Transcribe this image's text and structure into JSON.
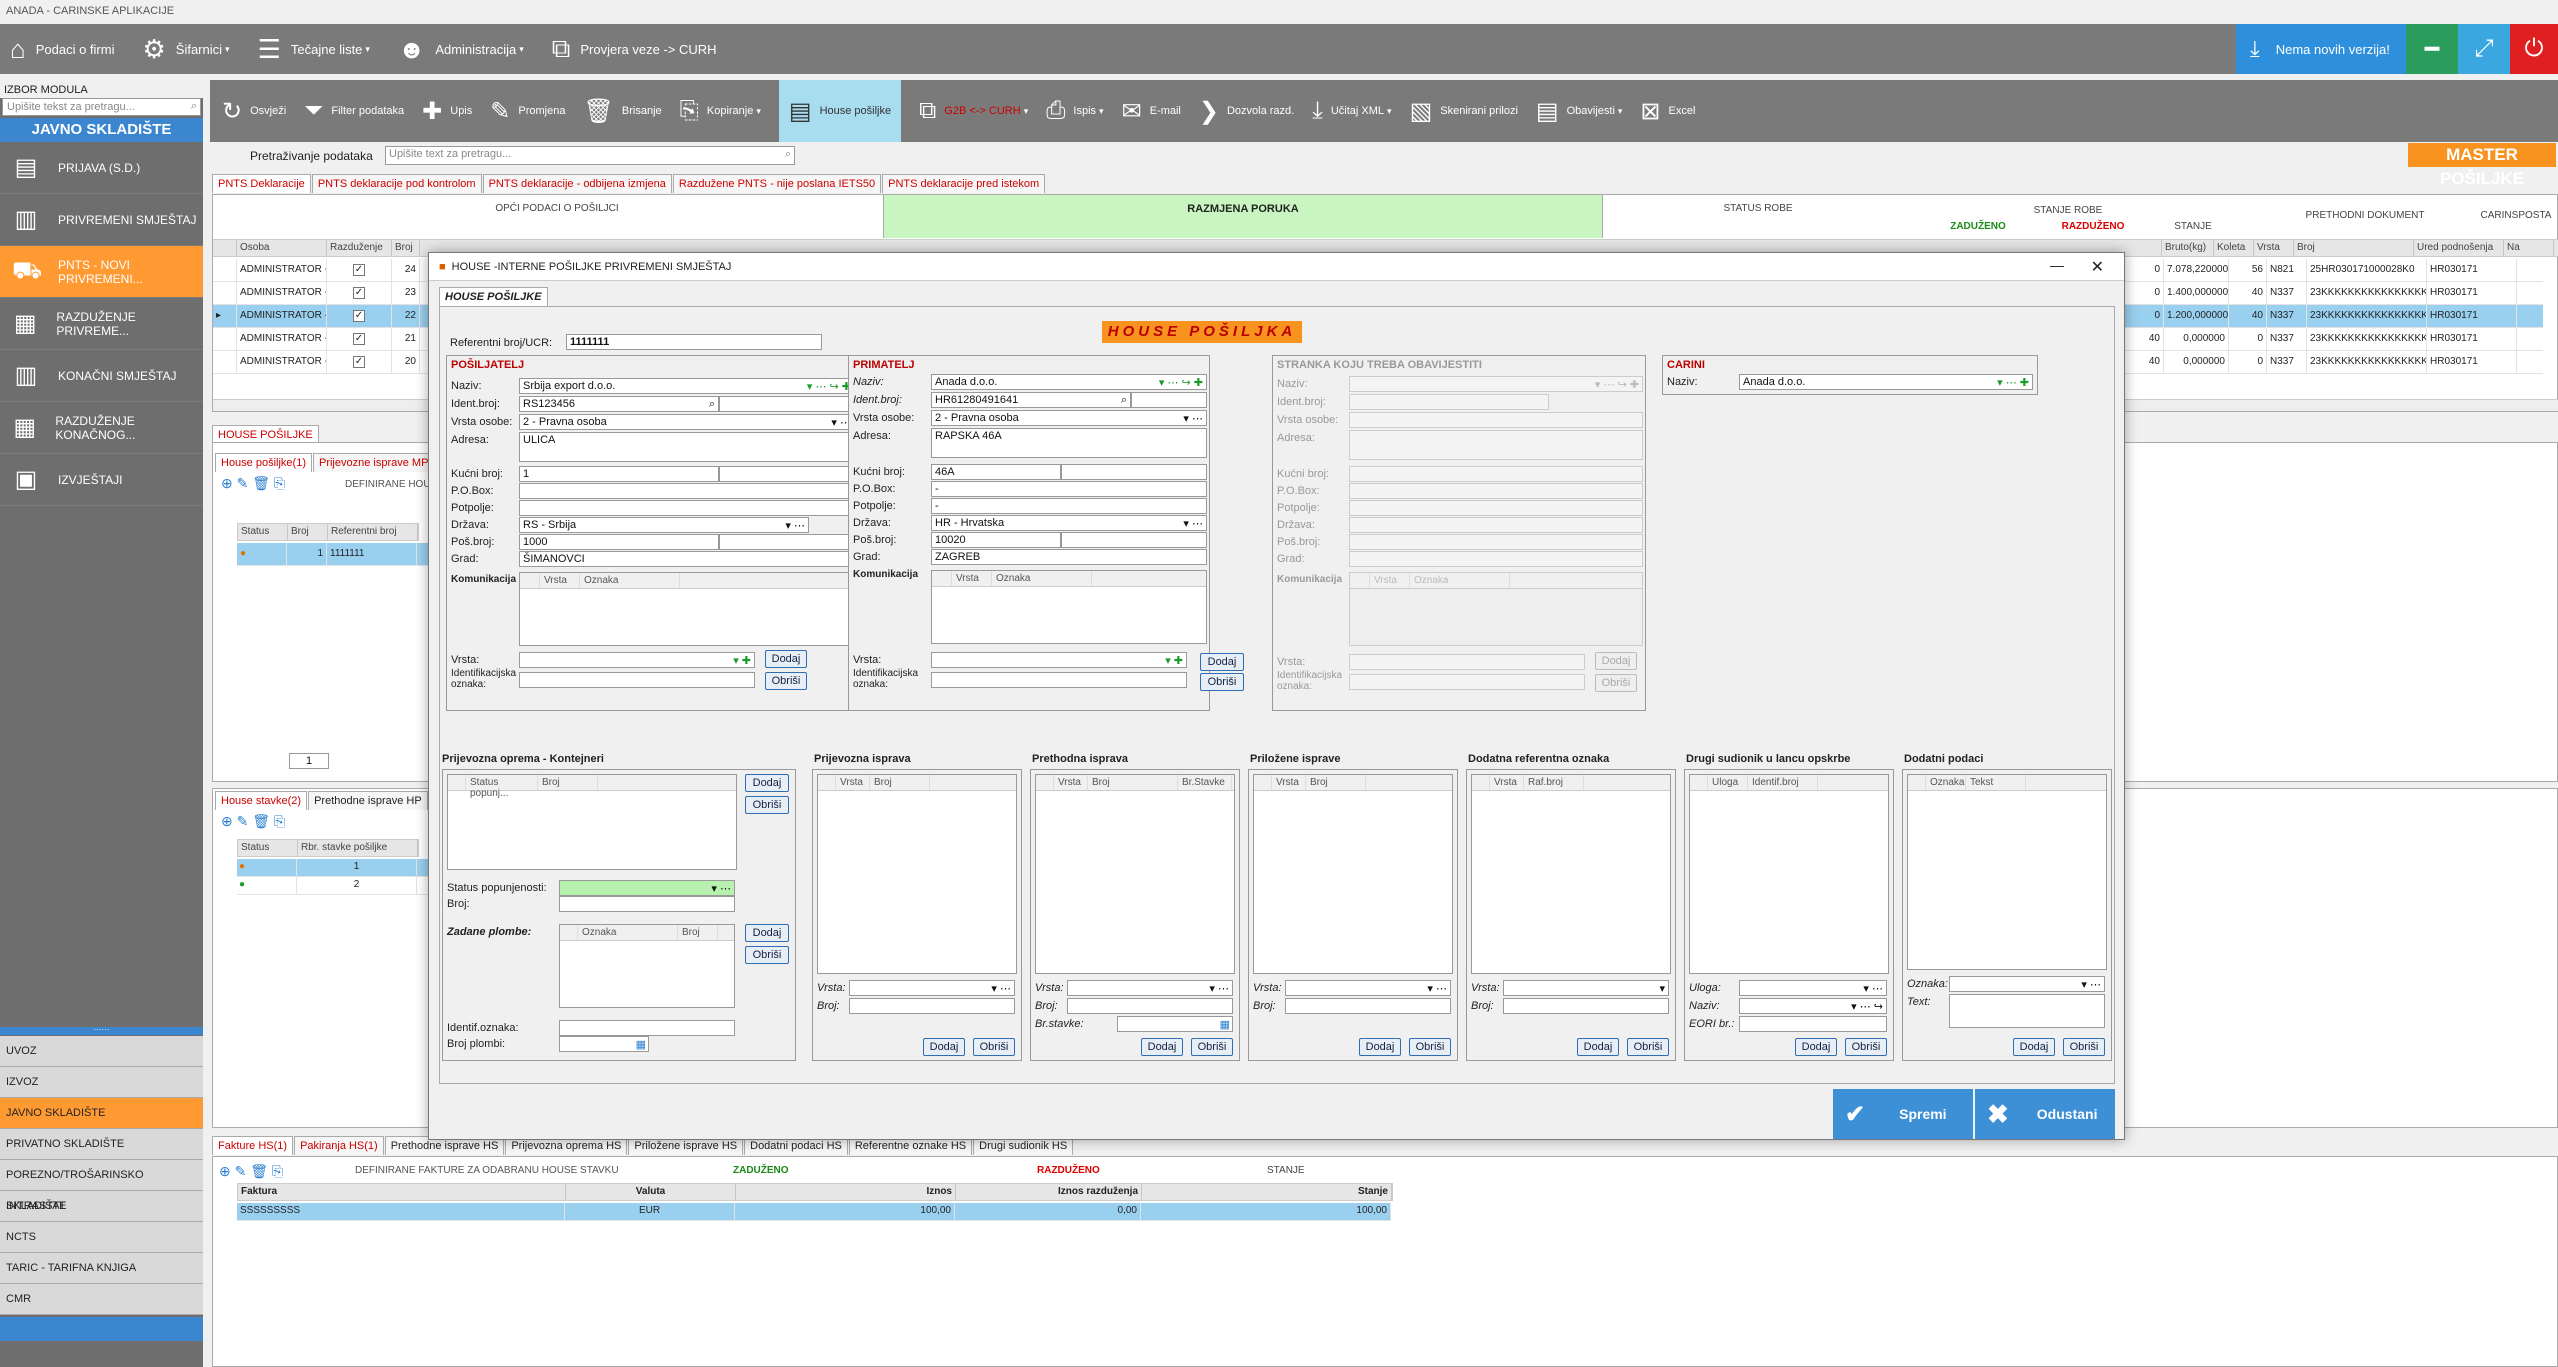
{
  "app": {
    "title": "ANADA - CARINSKE APLIKACIJE"
  },
  "topbar": {
    "items": [
      "Podaci o firmi",
      "Šifarnici",
      "Tečajne liste",
      "Administracija",
      "Provjera veze -> CURH"
    ],
    "new_version": "Nema novih verzija!"
  },
  "sidebar": {
    "header": "IZBOR MODULA",
    "search_placeholder": "Upišite tekst za pretragu...",
    "title": "JAVNO SKLADIŠTE",
    "items": [
      "PRIJAVA (S.D.)",
      "PRIVREMENI SMJEŠTAJ",
      "PNTS - NOVI PRIVREMENI...",
      "RAZDUŽENJE PRIVREME...",
      "KONAČNI SMJEŠTAJ",
      "RAZDUŽENJE KONAČNOG...",
      "IZVJEŠTAJI"
    ],
    "modules": [
      "UVOZ",
      "IZVOZ",
      "JAVNO SKLADIŠTE",
      "PRIVATNO SKLADIŠTE",
      "POREZNO/TROŠARINSKO SKLADIŠTE",
      "INTRASTAT",
      "NCTS",
      "TARIC - TARIFNA KNJIGA",
      "CMR"
    ]
  },
  "toolbar": {
    "items": [
      "Osvježi",
      "Filter podataka",
      "Upis",
      "Promjena",
      "Brisanje",
      "Kopiranje",
      "House pošiljke",
      "G2B <-> CURH",
      "Ispis",
      "E-mail",
      "Dozvola razd.",
      "Učitaj XML",
      "Skenirani prilozi",
      "Obavijesti",
      "Excel"
    ]
  },
  "search": {
    "label": "Pretraživanje podataka",
    "placeholder": "Upišite text za pretragu..."
  },
  "master_label": "MASTER POŠILJKE",
  "main_tabs": [
    "PNTS Deklaracije",
    "PNTS deklaracije pod kontrolom",
    "PNTS deklaracije - odbijena izmjena",
    "Razdužene PNTS - nije poslana IETS50",
    "PNTS deklaracije pred istekom"
  ],
  "main_grid": {
    "groups": [
      "OPĆI PODACI O POŠILJCI",
      "RAZMJENA PORUKA",
      "STATUS ROBE",
      "STANJE ROBE",
      "PRETHODNI DOKUMENT",
      "CARINSPOSTA"
    ],
    "subgroups": [
      "ZADUŽENO",
      "RAZDUŽENO",
      "STANJE"
    ],
    "headers": [
      "Osoba",
      "Razduženje",
      "Broj",
      "Bruto(kg)",
      "Koleta",
      "Vrsta",
      "Broj",
      "Ured podnošenja",
      "Na"
    ],
    "rows": [
      {
        "osoba": "ADMINISTRATOR -",
        "broj": "24",
        "c1": "0",
        "bruto": "7.078,220000",
        "koleta": "56",
        "vrsta": "N821",
        "pbroj": "25HR030171000028K0",
        "ured": "HR030171"
      },
      {
        "osoba": "ADMINISTRATOR -",
        "broj": "23",
        "c1": "0",
        "bruto": "1.400,000000",
        "koleta": "40",
        "vrsta": "N337",
        "pbroj": "23KKKKKKKKKKKKKKKK",
        "ured": "HR030171"
      },
      {
        "osoba": "ADMINISTRATOR -",
        "broj": "22",
        "c1": "0",
        "bruto": "1.200,000000",
        "koleta": "40",
        "vrsta": "N337",
        "pbroj": "23KKKKKKKKKKKKKKKK",
        "ured": "HR030171"
      },
      {
        "osoba": "ADMINISTRATOR -",
        "broj": "21",
        "c1": "40",
        "bruto": "0,000000",
        "koleta": "0",
        "vrsta": "N337",
        "pbroj": "23KKKKKKKKKKKKKKKK",
        "ured": "HR030171"
      },
      {
        "osoba": "ADMINISTRATOR -",
        "broj": "20",
        "c1": "40",
        "bruto": "0,000000",
        "koleta": "0",
        "vrsta": "N337",
        "pbroj": "23KKKKKKKKKKKKKKKK",
        "ured": "HR030171"
      }
    ]
  },
  "house_panel": {
    "tab": "HOUSE POŠILJKE",
    "subtabs": [
      "House pošiljke(1)",
      "Prijevozne isprave MP(1)"
    ],
    "toolbar_label": "DEFINIRANE HOU",
    "headers": [
      "Status",
      "Broj",
      "Referentni broj"
    ],
    "rows": [
      {
        "broj": "1",
        "ref": "1111111"
      }
    ],
    "pager": "1"
  },
  "stavke_panel": {
    "subtabs": [
      "House stavke(2)",
      "Prethodne isprave HP"
    ],
    "headers": [
      "Status",
      "Rbr. stavke pošiljke"
    ],
    "rows": [
      "1",
      "2"
    ],
    "pager": "2"
  },
  "bottom": {
    "tabs": [
      "Fakture HS(1)",
      "Pakiranja HS(1)",
      "Prethodne isprave HS",
      "Prijevozna oprema HS",
      "Priložene isprave HS",
      "Dodatni podaci HS",
      "Referentne oznake HS",
      "Drugi sudionik HS"
    ],
    "toolbar_label": "DEFINIRANE FAKTURE ZA ODABRANU HOUSE STAVKU",
    "zaduzeno": "ZADUŽENO",
    "razduzeno": "RAZDUŽENO",
    "stanje": "STANJE",
    "headers": [
      "Faktura",
      "Valuta",
      "Iznos",
      "Iznos razduženja",
      "Stanje"
    ],
    "row": {
      "faktura": "SSSSSSSSS",
      "valuta": "EUR",
      "iznos": "100,00",
      "razd": "0,00",
      "stanje": "100,00"
    }
  },
  "dialog": {
    "title": "HOUSE -INTERNE POŠILJKE  PRIVREMENI SMJEŠTAJ",
    "tab": "HOUSE POŠILJKE",
    "banner": "HOUSE POŠILJKA",
    "ref_label": "Referentni broj/UCR:",
    "ref_value": "1111111",
    "posiljatelj": {
      "title": "POŠILJATELJ",
      "naziv": "Srbija export d.o.o.",
      "ident": "RS123456",
      "vrsta_osobe": "2 - Pravna osoba",
      "adresa": "ULICA",
      "kucni_broj": "1",
      "pobox": "",
      "potpolje": "",
      "drzava": "RS - Srbija",
      "post_broj": "1000",
      "grad": "ŠIMANOVCI"
    },
    "primatelj": {
      "title": "PRIMATELJ",
      "naziv": "Anada d.o.o.",
      "ident": "HR61280491641",
      "vrsta_osobe": "2 - Pravna osoba",
      "adresa": "RAPSKA 46A",
      "kucni_broj": "46A",
      "pobox": "-",
      "potpolje": "-",
      "drzava": "HR - Hrvatska",
      "post_broj": "10020",
      "grad": "ZAGREB"
    },
    "stranka": {
      "title": "STRANKA KOJU TREBA OBAVIJESTITI"
    },
    "carini": {
      "title": "CARINI",
      "label": "Naziv:",
      "value": "Anada d.o.o."
    },
    "labels": {
      "naziv": "Naziv:",
      "ident": "Ident.broj:",
      "vrsta_osobe": "Vrsta osobe:",
      "adresa": "Adresa:",
      "kucni": "Kućni broj:",
      "pobox": "P.O.Box:",
      "potpolje": "Potpolje:",
      "drzava": "Država:",
      "post": "Poš.broj:",
      "grad": "Grad:",
      "komunikacija": "Komunikacija",
      "vrsta": "Vrsta",
      "oznaka": "Oznaka",
      "vrsta_c": "Vrsta:",
      "id_oznaka": "Identifikacijska oznaka:",
      "dodaj": "Dodaj",
      "obrisi": "Obriši"
    },
    "sections": {
      "oprema": "Prijevozna oprema - Kontejneri",
      "prijevozna": "Prijevozna isprava",
      "prethodna": "Prethodna isprava",
      "prilozene": "Priložene isprave",
      "dodatna_ref": "Dodatna referentna oznaka",
      "drugi": "Drugi sudionik u lancu opskrbe",
      "dodatni": "Dodatni podaci"
    },
    "oprema": {
      "h1": "Status popunj...",
      "h2": "Broj",
      "status_label": "Status popunjenosti:",
      "broj_label": "Broj:",
      "plombe_label": "Zadane plombe:",
      "ph1": "Oznaka",
      "ph2": "Broj",
      "ident_label": "Identif.oznaka:",
      "broj_plombi": "Broj plombi:"
    },
    "cols": {
      "vrsta": "Vrsta",
      "broj": "Broj",
      "br_stavke": "Br.Stavke",
      "raf_broj": "Raf.broj",
      "uloga": "Uloga",
      "identif": "Identif.broj",
      "oznaka": "Oznaka",
      "tekst": "Tekst"
    },
    "small": {
      "vrsta": "Vrsta:",
      "broj": "Broj:",
      "br_stavke": "Br.stavke:",
      "uloga": "Uloga:",
      "naziv": "Naziv:",
      "eori": "EORI br.:",
      "oznaka": "Oznaka:",
      "text": "Text:"
    },
    "save": "Spremi",
    "cancel": "Odustani"
  }
}
